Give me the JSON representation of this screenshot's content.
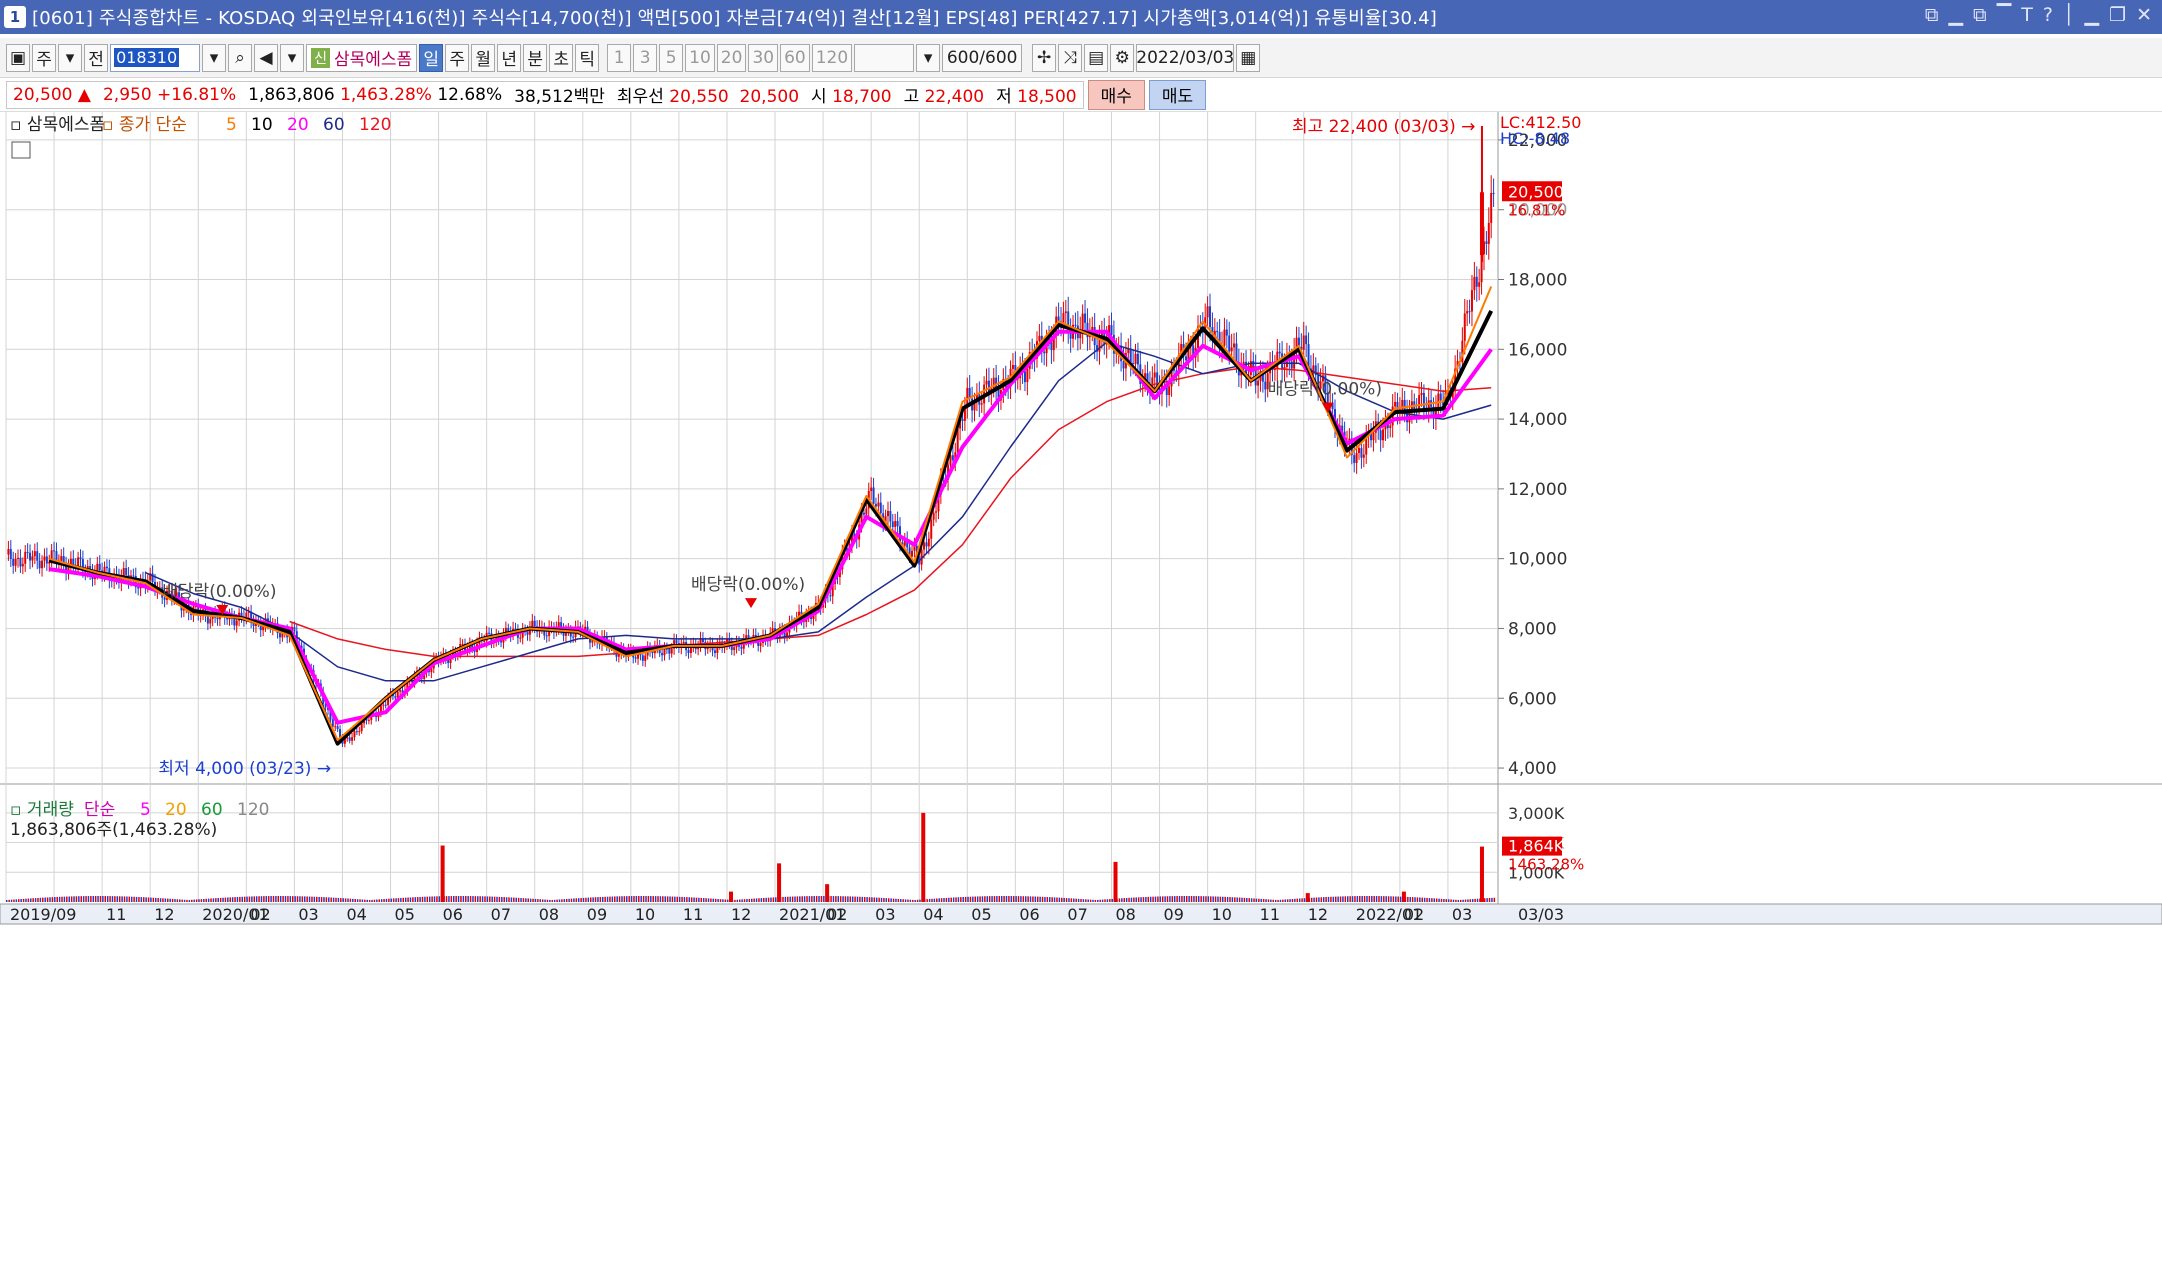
{
  "window": {
    "num": "1",
    "title": "[0601] 주식종합차트 - KOSDAQ 외국인보유[416(천)] 주식수[14,700(천)] 액면[500] 자본금[74(억)] 결산[12월] EPS[48] PER[427.17] 시가총액[3,014(억)] 유통비율[30.4]",
    "title_icons": [
      "⧉",
      "▁",
      "⧉",
      "▔",
      "T",
      "?",
      "│",
      "▁",
      "❐",
      "✕"
    ]
  },
  "toolbar": {
    "type_label": "주",
    "prev_label": "전",
    "code": "018310",
    "stock_name": "삼목에스폼",
    "new_badge": "신",
    "periods": [
      "일",
      "주",
      "월",
      "년",
      "분",
      "초",
      "틱"
    ],
    "active_period": "일",
    "intervals": [
      "1",
      "3",
      "5",
      "10",
      "20",
      "30",
      "60",
      "120"
    ],
    "count": "600/600",
    "date": "2022/03/03"
  },
  "quote": {
    "price": "20,500",
    "arrow": "▲",
    "change": "2,950",
    "change_pct": "+16.81%",
    "volume": "1,863,806",
    "volume_pct": "1,463.28%",
    "turnover": "12.68%",
    "amount": "38,512백만",
    "best_label": "최우선",
    "ask": "20,550",
    "bid": "20,500",
    "open_label": "시",
    "open": "18,700",
    "high_label": "고",
    "high": "22,400",
    "low_label": "저",
    "low": "18,500",
    "buy_label": "매수",
    "sell_label": "매도"
  },
  "colors": {
    "up": "#e60000",
    "down": "#1b3fd1",
    "ma5": "#ff7a00",
    "ma10": "#000000",
    "ma20": "#ff00ff",
    "ma60": "#1c2a8c",
    "ma120": "#e8141e",
    "grid": "#d4d4d4"
  },
  "chart_data": [
    {
      "type": "line",
      "title": "삼목에스폼",
      "legend": "종가 단순",
      "ma_periods": [
        "5",
        "10",
        "20",
        "60",
        "120"
      ],
      "ylim": [
        3600,
        22800
      ],
      "yticks": [
        "22,000",
        "18,000",
        "16,000",
        "14,000",
        "12,000",
        "10,000",
        "8,000",
        "6,000",
        "4,000"
      ],
      "y_label_partial": "20,000",
      "lc_label": "LC:412.50",
      "hc_label": "HC:-8.48",
      "current_price": "20,500",
      "current_pct": "16.81%",
      "annotations": {
        "high": "최고 22,400 (03/03)",
        "low": "최저 4,000 (03/23)",
        "dividend": "배당락(0.00%)"
      },
      "x": [
        "2019-09",
        "2019-10",
        "2019-11",
        "2019-12",
        "2020-01",
        "2020-02",
        "2020-03",
        "2020-04",
        "2020-05",
        "2020-06",
        "2020-07",
        "2020-08",
        "2020-09",
        "2020-10",
        "2020-11",
        "2020-12",
        "2021-01",
        "2021-02",
        "2021-03",
        "2021-04",
        "2021-05",
        "2021-06",
        "2021-07",
        "2021-08",
        "2021-09",
        "2021-10",
        "2021-11",
        "2021-12",
        "2022-01",
        "2022-02",
        "2022-03"
      ],
      "series": [
        {
          "name": "종가",
          "values": [
            10000,
            9600,
            9300,
            8400,
            8300,
            7800,
            4700,
            6000,
            7100,
            7700,
            8000,
            7900,
            7200,
            7500,
            7500,
            7800,
            8700,
            11800,
            9900,
            14500,
            15200,
            16800,
            16200,
            14800,
            16800,
            15100,
            16100,
            12900,
            14300,
            14500,
            20500
          ]
        },
        {
          "name": "5",
          "values": [
            10000,
            9600,
            9300,
            8400,
            8300,
            7800,
            4800,
            6000,
            7100,
            7700,
            8000,
            7900,
            7200,
            7500,
            7500,
            7800,
            8700,
            11800,
            9900,
            14500,
            15200,
            16800,
            16200,
            14800,
            16800,
            15100,
            16100,
            12900,
            14300,
            14500,
            17800
          ]
        },
        {
          "name": "10",
          "values": [
            9950,
            9600,
            9350,
            8500,
            8300,
            7900,
            4700,
            6000,
            7100,
            7700,
            8000,
            7900,
            7300,
            7500,
            7500,
            7800,
            8600,
            11700,
            9800,
            14300,
            15100,
            16700,
            16300,
            14800,
            16600,
            15100,
            16000,
            13100,
            14200,
            14300,
            17100
          ]
        },
        {
          "name": "20",
          "values": [
            9700,
            9500,
            9200,
            8700,
            8300,
            8000,
            5300,
            5600,
            7000,
            7500,
            8000,
            8000,
            7400,
            7500,
            7500,
            7700,
            8500,
            11200,
            10400,
            13200,
            15000,
            16500,
            16500,
            14600,
            16100,
            15400,
            15800,
            13300,
            14000,
            14100,
            16000
          ]
        },
        {
          "name": "60",
          "values": [
            null,
            null,
            9600,
            9000,
            8600,
            7900,
            6900,
            6500,
            6500,
            6900,
            7300,
            7700,
            7800,
            7700,
            7700,
            7700,
            7900,
            8900,
            9800,
            11200,
            13200,
            15100,
            16200,
            15800,
            15300,
            15600,
            15600,
            14800,
            14200,
            14000,
            14400
          ]
        },
        {
          "name": "120",
          "values": [
            null,
            null,
            null,
            null,
            null,
            8200,
            7700,
            7400,
            7200,
            7200,
            7200,
            7200,
            7300,
            7500,
            7600,
            7700,
            7800,
            8400,
            9100,
            10400,
            12300,
            13700,
            14500,
            15000,
            15300,
            15500,
            15400,
            15200,
            15000,
            14800,
            14900
          ]
        }
      ]
    },
    {
      "type": "bar",
      "title": "거래량",
      "legend": "단순",
      "ma_periods": [
        "5",
        "20",
        "60",
        "120"
      ],
      "current_volume": "1,863,806주(1,463.28%)",
      "yticks": [
        "3,000K",
        "1,000K"
      ],
      "y_label_partial": "2,000K",
      "current_label": "1,864K",
      "current_pct": "1463.28%",
      "ylim": [
        0,
        3600000
      ],
      "spikes": [
        {
          "x": "2020-06",
          "value": 1900000
        },
        {
          "x": "2020-12",
          "value": 350000
        },
        {
          "x": "2021-01",
          "value": 1300000
        },
        {
          "x": "2021-02",
          "value": 600000
        },
        {
          "x": "2021-04",
          "value": 3000000
        },
        {
          "x": "2021-08",
          "value": 1350000
        },
        {
          "x": "2021-12",
          "value": 300000
        },
        {
          "x": "2022-02",
          "value": 350000
        },
        {
          "x": "2022-03",
          "value": 1864000
        }
      ]
    }
  ],
  "xaxis": {
    "labels": [
      "2019/09",
      "11",
      "12",
      "2020/01",
      "02",
      "03",
      "04",
      "05",
      "06",
      "07",
      "08",
      "09",
      "10",
      "11",
      "12",
      "2021/01",
      "02",
      "03",
      "04",
      "05",
      "06",
      "07",
      "08",
      "09",
      "10",
      "11",
      "12",
      "2022/01",
      "02",
      "03"
    ],
    "right_label": "03/03"
  }
}
